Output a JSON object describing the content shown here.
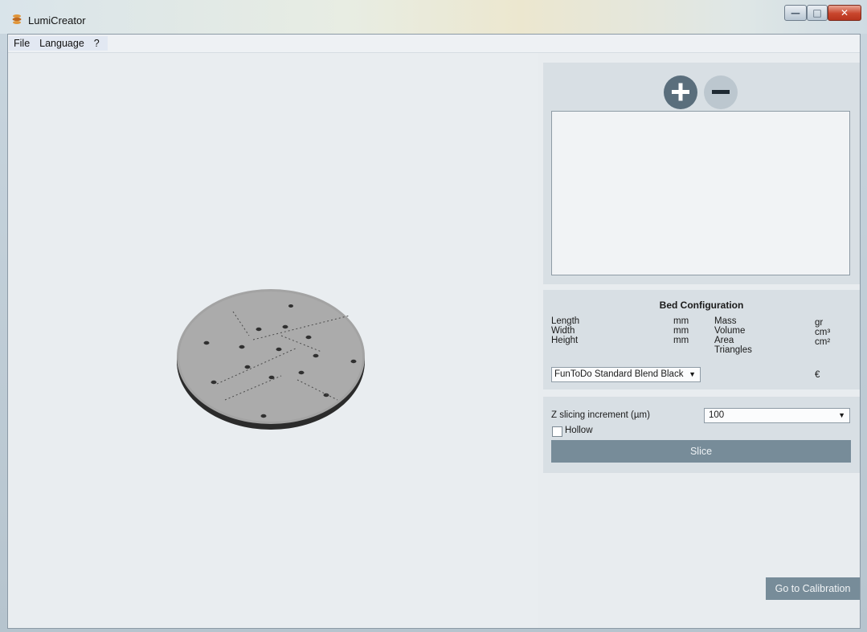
{
  "window": {
    "title": "LumiCreator",
    "controls": {
      "minimize": "—",
      "maximize": "□",
      "close": "✕"
    }
  },
  "menu": [
    "File",
    "Language",
    "?"
  ],
  "model_panel": {
    "add_icon": "plus-circle-icon",
    "remove_icon": "minus-circle-icon"
  },
  "bed": {
    "title": "Bed Configuration",
    "left_labels": [
      "Length",
      "Width",
      "Height"
    ],
    "left_units": [
      "mm",
      "mm",
      "mm"
    ],
    "right_labels": [
      "Mass",
      "Volume",
      "Area",
      "Triangles"
    ],
    "right_units": [
      "gr",
      "cm³",
      "cm²"
    ],
    "material": "FunToDo Standard Blend Black",
    "currency": "€"
  },
  "slicing": {
    "label": "Z slicing increment (µm)",
    "value": "100",
    "hollow_label": "Hollow",
    "hollow_checked": false,
    "slice_button": "Slice"
  },
  "calibration_button": "Go to Calibration",
  "colors": {
    "button_bg": "#778c99",
    "panel_bg": "#d8dfe4",
    "viewport_bg": "#e9edf0"
  }
}
